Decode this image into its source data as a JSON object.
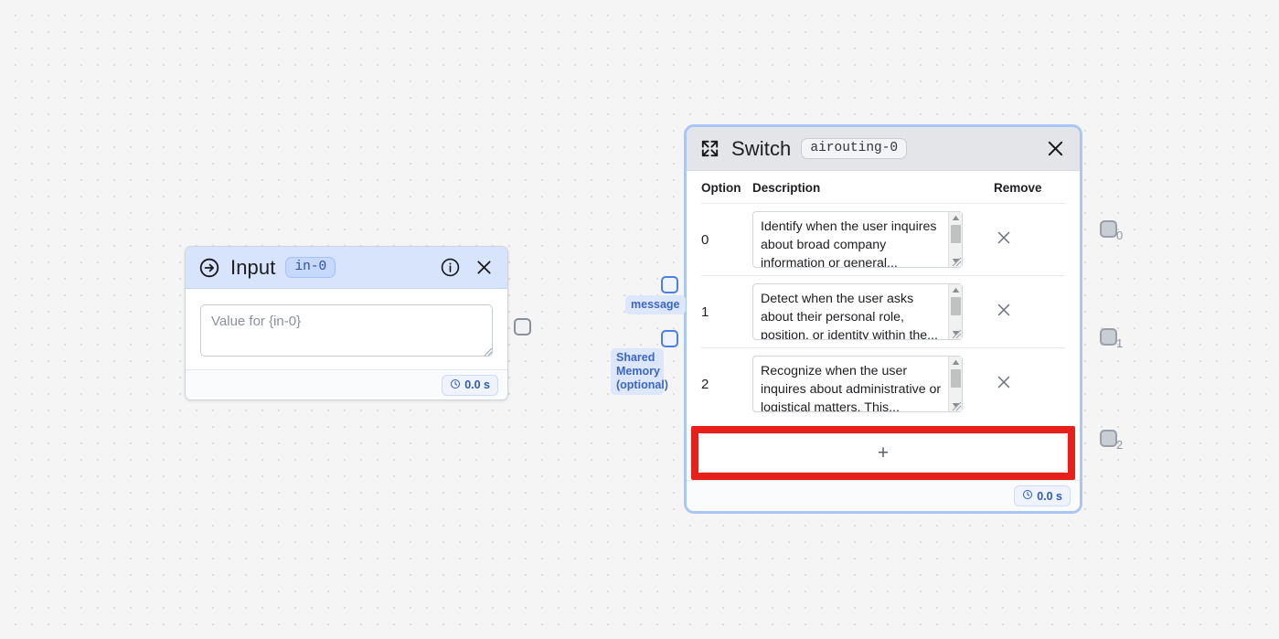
{
  "canvas": {
    "background_color": "#f5f5f5",
    "dot_color": "#dcdcdc"
  },
  "input_node": {
    "icon": "arrow-right-circle-icon",
    "title": "Input",
    "badge": "in-0",
    "info_icon": "info-icon",
    "close_icon": "close-icon",
    "value_field": {
      "value": "",
      "placeholder": "Value for {in-0}"
    },
    "footer": {
      "clock_icon": "clock-icon",
      "time": "0.0 s"
    },
    "output_port": {
      "name": "output-port"
    }
  },
  "switch_node": {
    "icon": "expand-icon",
    "title": "Switch",
    "badge": "airouting-0",
    "close_icon": "close-icon",
    "columns": {
      "option": "Option",
      "description": "Description",
      "remove": "Remove"
    },
    "rows": [
      {
        "option": "0",
        "description": "Identify when the user inquires about broad company information or general..."
      },
      {
        "option": "1",
        "description": "Detect when the user asks about their personal role, position, or identity within the..."
      },
      {
        "option": "2",
        "description": "Recognize when the user inquires about administrative or logistical matters. This..."
      }
    ],
    "add_button": {
      "label": "+",
      "highlighted": true,
      "highlight_color": "#e8201a"
    },
    "footer": {
      "clock_icon": "clock-icon",
      "time": "0.0 s"
    },
    "input_ports": [
      {
        "label": "message"
      },
      {
        "label": "Shared Memory (optional)"
      }
    ],
    "output_ports": [
      {
        "label": "0"
      },
      {
        "label": "1"
      },
      {
        "label": "2"
      }
    ]
  }
}
